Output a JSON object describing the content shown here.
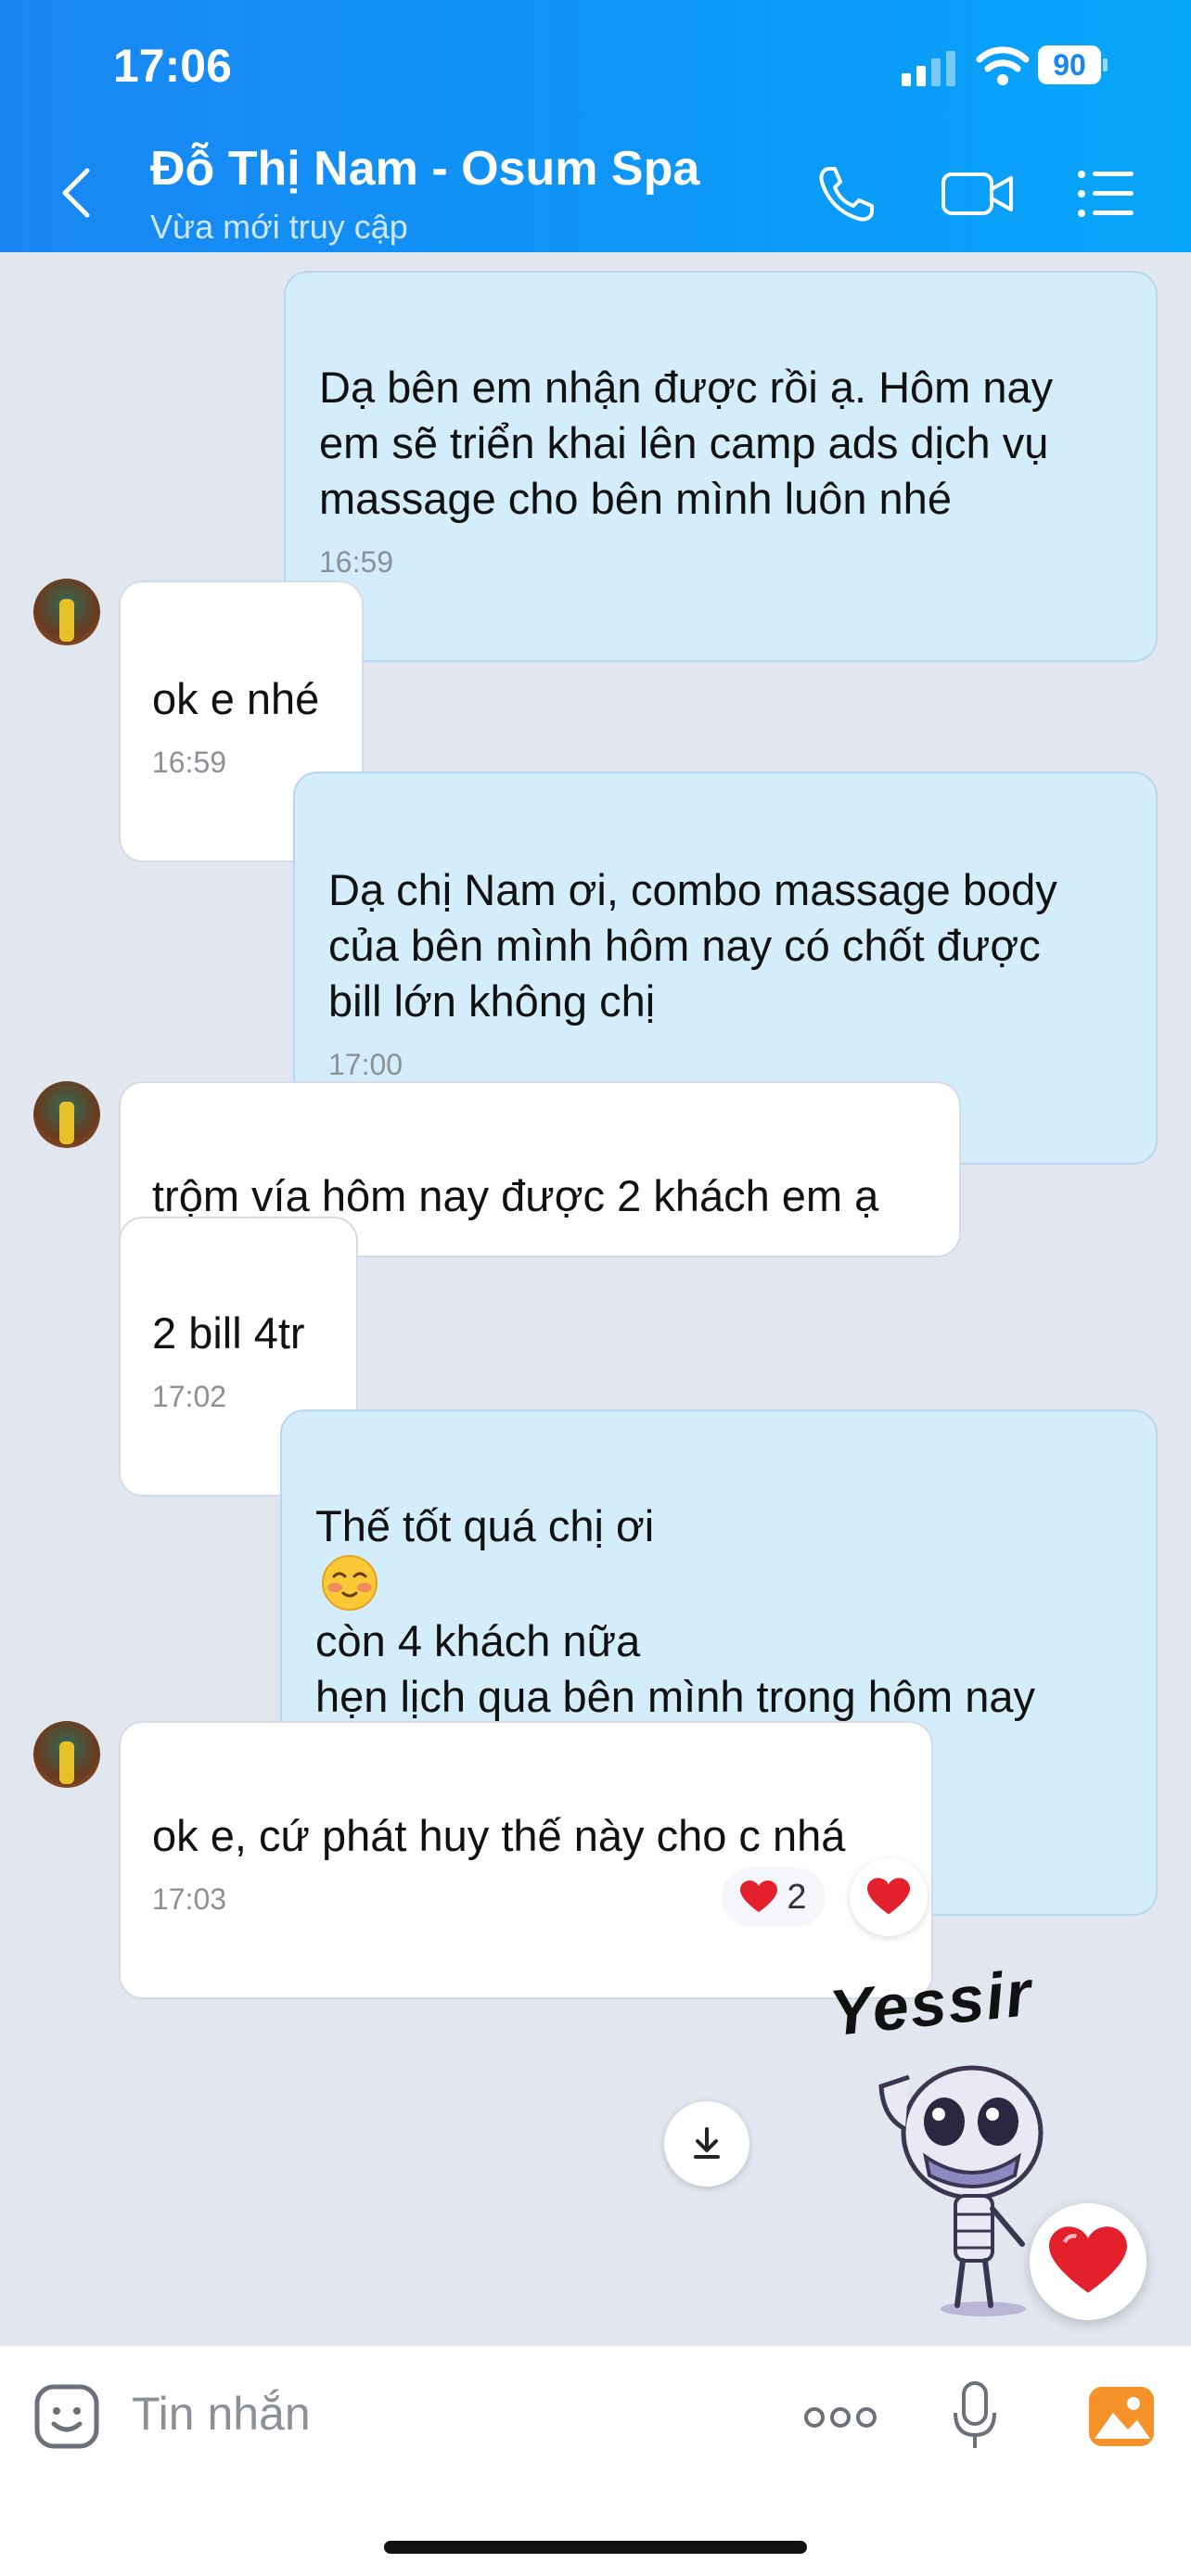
{
  "status_bar": {
    "time": "17:06",
    "battery": "90"
  },
  "header": {
    "contact_name": "Đỗ Thị Nam - Osum Spa",
    "contact_status": "Vừa mới truy cập"
  },
  "messages": [
    {
      "direction": "out",
      "text": "Dạ bên em nhận được rồi ạ. Hôm nay\nem sẽ triển khai lên camp ads dịch vụ\nmassage cho bên mình luôn nhé",
      "time": "16:59"
    },
    {
      "direction": "in",
      "text": "ok e nhé",
      "time": "16:59"
    },
    {
      "direction": "out",
      "text": "Dạ chị Nam ơi, combo massage body\ncủa bên mình hôm nay có chốt được\nbill lớn không chị",
      "time": "17:00"
    },
    {
      "direction": "in",
      "text": "trộm vía hôm nay được 2 khách em ạ",
      "time": ""
    },
    {
      "direction": "in",
      "text": "2 bill 4tr",
      "time": "17:02"
    },
    {
      "direction": "out",
      "text_before_emoji": "Thế tốt quá chị ơi",
      "text_after_emoji": " còn 4 khách nữa\nhẹn lịch qua bên mình trong hôm nay\nđó ạ",
      "time": "17:03"
    },
    {
      "direction": "in",
      "text": "ok e, cứ phát huy thế này cho c nhá",
      "time": "17:03",
      "reaction_count": "2"
    }
  ],
  "sticker": {
    "text": "Yessir"
  },
  "input": {
    "placeholder": "Tin nhắn"
  },
  "colors": {
    "header": "#1a86f2",
    "outgoing_bubble": "#d3edfb",
    "incoming_bubble": "#ffffff",
    "heart": "#e3202c"
  }
}
